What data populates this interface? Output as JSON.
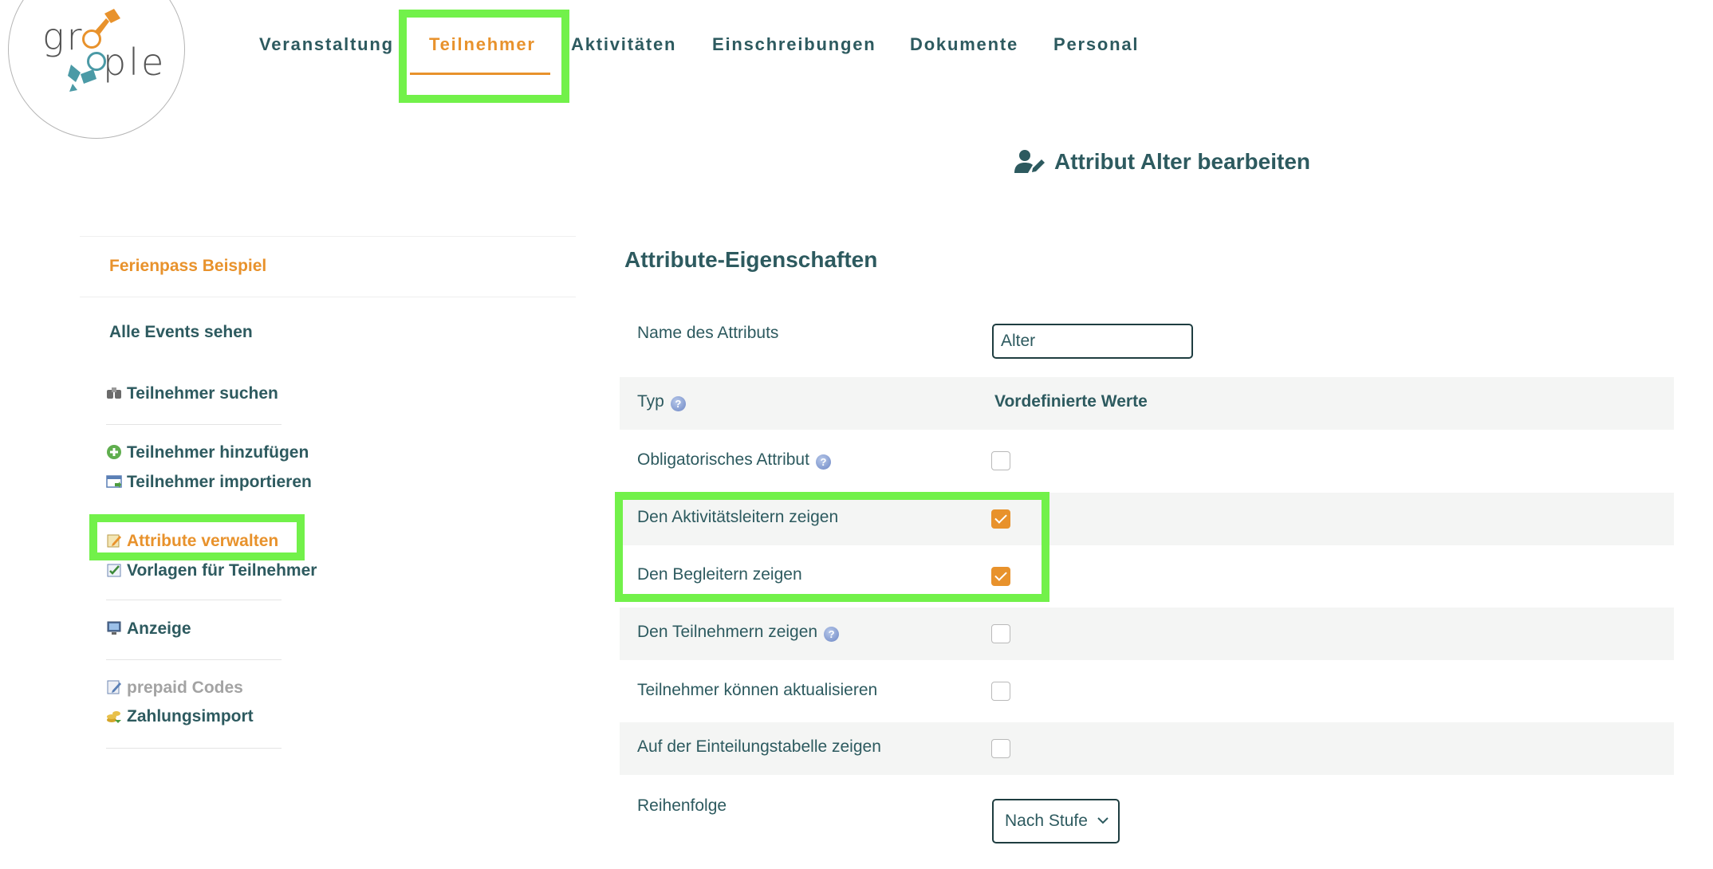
{
  "logo": {
    "text_top": "gr",
    "text_bottom": "ple"
  },
  "nav": {
    "items": [
      {
        "label": "Veranstaltung"
      },
      {
        "label": "Teilnehmer"
      },
      {
        "label": "Aktivitäten"
      },
      {
        "label": "Einschreibungen"
      },
      {
        "label": "Dokumente"
      },
      {
        "label": "Personal"
      }
    ],
    "active_index": 1
  },
  "page": {
    "title": "Attribut Alter bearbeiten",
    "title_icon": "user-edit-icon"
  },
  "sidebar": {
    "event_name": "Ferienpass Beispiel",
    "all_events": "Alle Events sehen",
    "links": [
      {
        "label": "Teilnehmer suchen",
        "icon": "binoculars-icon"
      },
      {
        "label": "Teilnehmer hinzufügen",
        "icon": "add-circle-icon"
      },
      {
        "label": "Teilnehmer importieren",
        "icon": "import-window-icon"
      },
      {
        "label": "Attribute verwalten",
        "icon": "edit-note-icon",
        "active": true
      },
      {
        "label": "Vorlagen für Teilnehmer",
        "icon": "template-check-icon"
      },
      {
        "label": "Anzeige",
        "icon": "monitor-icon"
      },
      {
        "label": "prepaid Codes",
        "icon": "codes-note-icon",
        "disabled": true
      },
      {
        "label": "Zahlungsimport",
        "icon": "coins-icon"
      }
    ]
  },
  "form": {
    "section_title": "Attribute-Eigenschaften",
    "name_label": "Name des Attributs",
    "name_value": "Alter",
    "type_label": "Typ",
    "type_value": "Vordefinierte Werte",
    "checkbox_rows": [
      {
        "label": "Obligatorisches Attribut",
        "help": true,
        "checked": false
      },
      {
        "label": "Den Aktivitätsleitern zeigen",
        "help": false,
        "checked": true
      },
      {
        "label": "Den Begleitern zeigen",
        "help": false,
        "checked": true
      },
      {
        "label": "Den Teilnehmern zeigen",
        "help": true,
        "checked": false
      },
      {
        "label": "Teilnehmer können aktualisieren",
        "help": false,
        "checked": false
      },
      {
        "label": "Auf der Einteilungstabelle zeigen",
        "help": false,
        "checked": false
      }
    ],
    "order_label": "Reihenfolge",
    "order_value": "Nach Stufe"
  },
  "colors": {
    "accent": "#e8922c",
    "text": "#2d5a5f",
    "highlight": "#72f14a",
    "row_shade": "#f4f5f4"
  }
}
